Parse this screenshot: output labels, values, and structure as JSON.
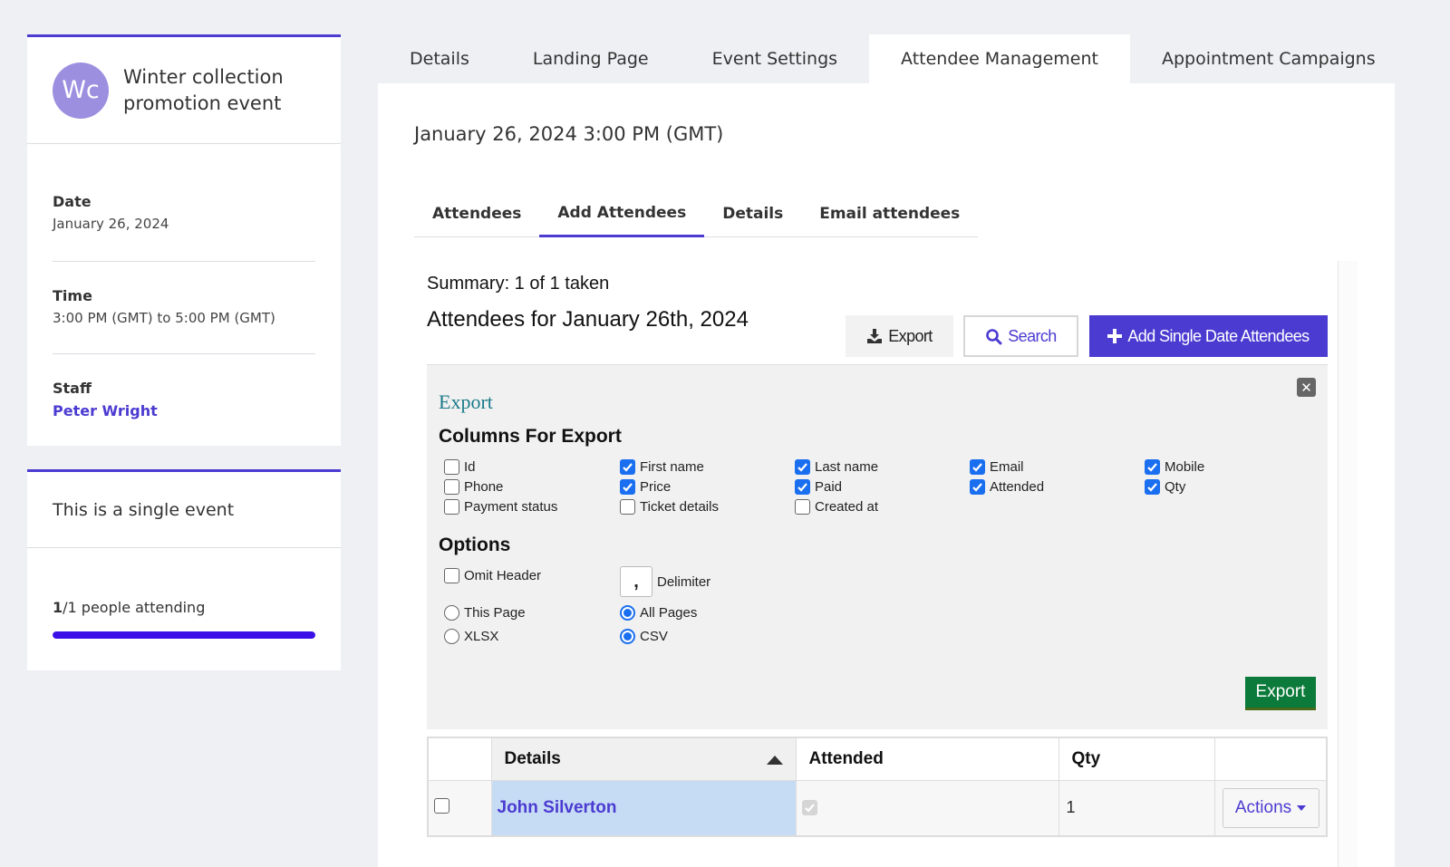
{
  "sidebar": {
    "avatar_initials": "Wc",
    "event_title_line1": "Winter collection",
    "event_title_line2": "promotion event",
    "date_label": "Date",
    "date_value": "January 26, 2024",
    "time_label": "Time",
    "time_value": "3:00 PM (GMT) to 5:00 PM (GMT)",
    "staff_label": "Staff",
    "staff_value": "Peter Wright",
    "single_event_text": "This is a single event",
    "attending_count": "1",
    "attending_rest": "/1 people attending",
    "attending_progress": 1.0
  },
  "top_tabs": [
    {
      "label": "Details",
      "active": false
    },
    {
      "label": "Landing Page",
      "active": false
    },
    {
      "label": "Event Settings",
      "active": false
    },
    {
      "label": "Attendee Management",
      "active": true
    },
    {
      "label": "Appointment Campaigns",
      "active": false
    }
  ],
  "main": {
    "date_heading": "January 26, 2024 3:00 PM (GMT)",
    "sub_tabs": [
      {
        "label": "Attendees",
        "active": false
      },
      {
        "label": "Add Attendees",
        "active": true
      },
      {
        "label": "Details",
        "active": false
      },
      {
        "label": "Email attendees",
        "active": false
      }
    ],
    "summary": "Summary: 1 of 1 taken",
    "attendees_heading": "Attendees for January 26th, 2024",
    "buttons": {
      "export": "Export",
      "search": "Search",
      "add_single": "Add Single Date Attendees"
    }
  },
  "export_panel": {
    "title": "Export",
    "close_glyph": "✕",
    "columns_heading": "Columns For Export",
    "options_heading": "Options",
    "columns": [
      {
        "label": "Id",
        "checked": false
      },
      {
        "label": "Phone",
        "checked": false
      },
      {
        "label": "Payment status",
        "checked": false
      },
      {
        "label": "First name",
        "checked": true
      },
      {
        "label": "Price",
        "checked": true
      },
      {
        "label": "Ticket details",
        "checked": false
      },
      {
        "label": "Last name",
        "checked": true
      },
      {
        "label": "Paid",
        "checked": true
      },
      {
        "label": "Created at",
        "checked": false
      },
      {
        "label": "Email",
        "checked": true
      },
      {
        "label": "Attended",
        "checked": true
      },
      {
        "label": "Mobile",
        "checked": true
      },
      {
        "label": "Qty",
        "checked": true
      }
    ],
    "omit_header_label": "Omit Header",
    "omit_header_checked": false,
    "delimiter_value": ",",
    "delimiter_label": "Delimiter",
    "scope_options": [
      {
        "label": "This Page",
        "selected": false
      },
      {
        "label": "All Pages",
        "selected": true
      }
    ],
    "format_options": [
      {
        "label": "XLSX",
        "selected": false
      },
      {
        "label": "CSV",
        "selected": true
      }
    ],
    "export_button": "Export"
  },
  "table": {
    "headers": [
      "",
      "Details",
      "Attended",
      "Qty",
      ""
    ],
    "rows": [
      {
        "name": "John Silverton",
        "attended": true,
        "qty": "1",
        "actions_label": "Actions"
      }
    ]
  }
}
